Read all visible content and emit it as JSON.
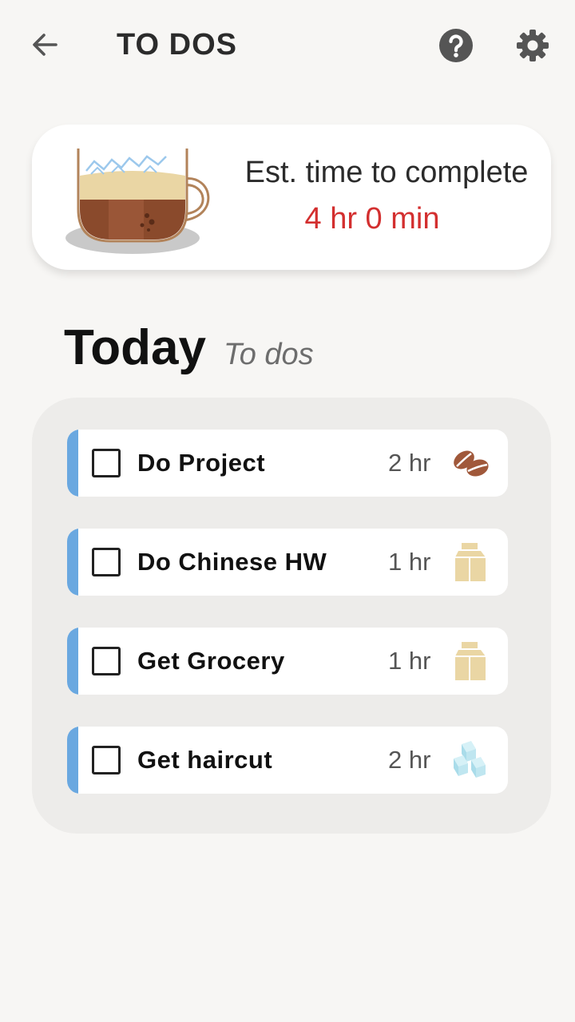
{
  "header": {
    "title": "TO DOS",
    "back_icon": "arrow-left-icon",
    "help_icon": "help-circle-icon",
    "settings_icon": "gear-icon"
  },
  "estimate": {
    "label": "Est. time to complete",
    "value": "4 hr 0 min",
    "value_color": "#d32f2f",
    "illustration": "coffee-cup-icon"
  },
  "section": {
    "title": "Today",
    "subtitle": "To dos"
  },
  "todos": [
    {
      "label": "Do Project",
      "duration": "2 hr",
      "checked": false,
      "icon": "coffee-beans-icon"
    },
    {
      "label": "Do Chinese HW",
      "duration": "1 hr",
      "checked": false,
      "icon": "milk-carton-icon"
    },
    {
      "label": "Get Grocery",
      "duration": "1 hr",
      "checked": false,
      "icon": "milk-carton-icon"
    },
    {
      "label": "Get haircut",
      "duration": "2 hr",
      "checked": false,
      "icon": "ice-cubes-icon"
    }
  ],
  "colors": {
    "accent": "#6aa8e0",
    "background": "#f7f6f4",
    "panel": "#edecea",
    "coffee": "#a0583a",
    "milk": "#ead6a4",
    "ice": "#bfe6f0"
  }
}
